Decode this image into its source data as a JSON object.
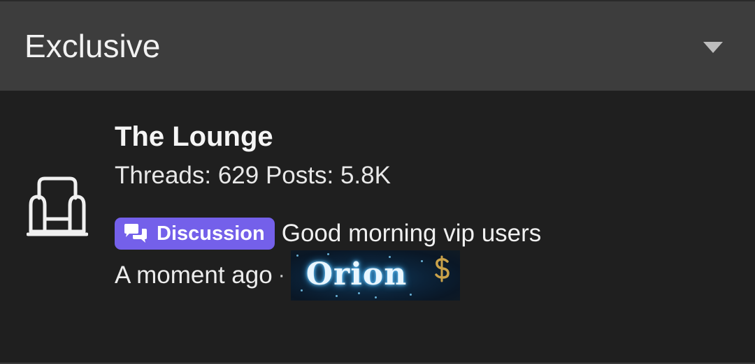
{
  "category": {
    "title": "Exclusive",
    "toggle_icon": "caret-down-icon"
  },
  "node": {
    "icon": "armchair-icon",
    "title": "The Lounge",
    "stats": "Threads: 629 Posts: 5.8K",
    "latest": {
      "prefix_icon": "chat-bubbles-icon",
      "prefix_label": "Discussion",
      "prefix_color": "#7460ea",
      "thread_title": "Good morning vip users",
      "time": "A moment ago",
      "separator": "·",
      "username": "Orion",
      "user_badge_icon": "dollar-sign-icon"
    }
  },
  "colors": {
    "header_bg": "#3d3d3d",
    "body_bg": "#1f1f1f",
    "text": "#f2f2f2"
  }
}
